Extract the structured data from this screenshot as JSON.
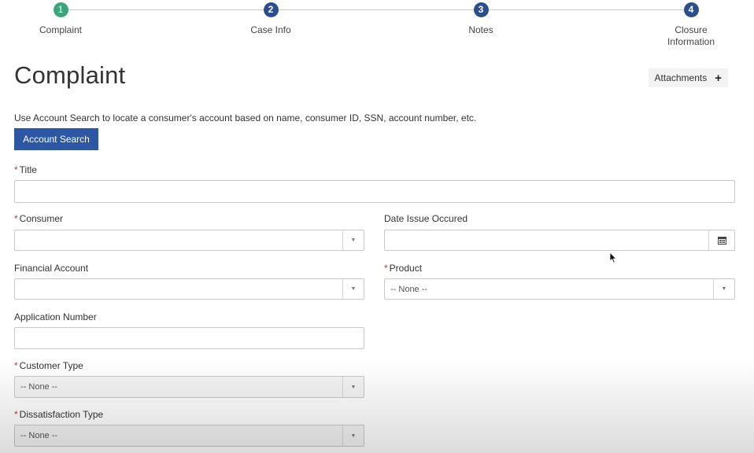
{
  "stepper": {
    "steps": [
      {
        "number": "1",
        "label": "Complaint",
        "status": "done"
      },
      {
        "number": "2",
        "label": "Case Info",
        "status": "todo"
      },
      {
        "number": "3",
        "label": "Notes",
        "status": "todo"
      },
      {
        "number": "4",
        "label": "Closure Information",
        "status": "todo"
      }
    ]
  },
  "header": {
    "title": "Complaint",
    "attachments_label": "Attachments",
    "attachments_icon": "plus-icon"
  },
  "account_search": {
    "help_text": "Use Account Search to locate a consumer's account based on name, consumer ID, SSN, account number, etc.",
    "button_label": "Account Search"
  },
  "form": {
    "title": {
      "label": "Title",
      "required": true,
      "value": ""
    },
    "consumer": {
      "label": "Consumer",
      "required": true,
      "value": ""
    },
    "date_issue": {
      "label": "Date Issue Occured",
      "required": false,
      "value": "",
      "icon": "calendar-icon"
    },
    "financial_account": {
      "label": "Financial Account",
      "required": false,
      "value": ""
    },
    "product": {
      "label": "Product",
      "required": true,
      "value": "-- None --"
    },
    "application_number": {
      "label": "Application Number",
      "required": false,
      "value": ""
    },
    "customer_type": {
      "label": "Customer Type",
      "required": true,
      "value": "-- None --"
    },
    "dissatisfaction_type": {
      "label": "Dissatisfaction Type",
      "required": true,
      "value": "-- None --"
    }
  },
  "colors": {
    "step_done": "#3aa57a",
    "step_todo": "#2c4f8c",
    "primary_button": "#2c57a5",
    "required_marker": "#c23934"
  }
}
